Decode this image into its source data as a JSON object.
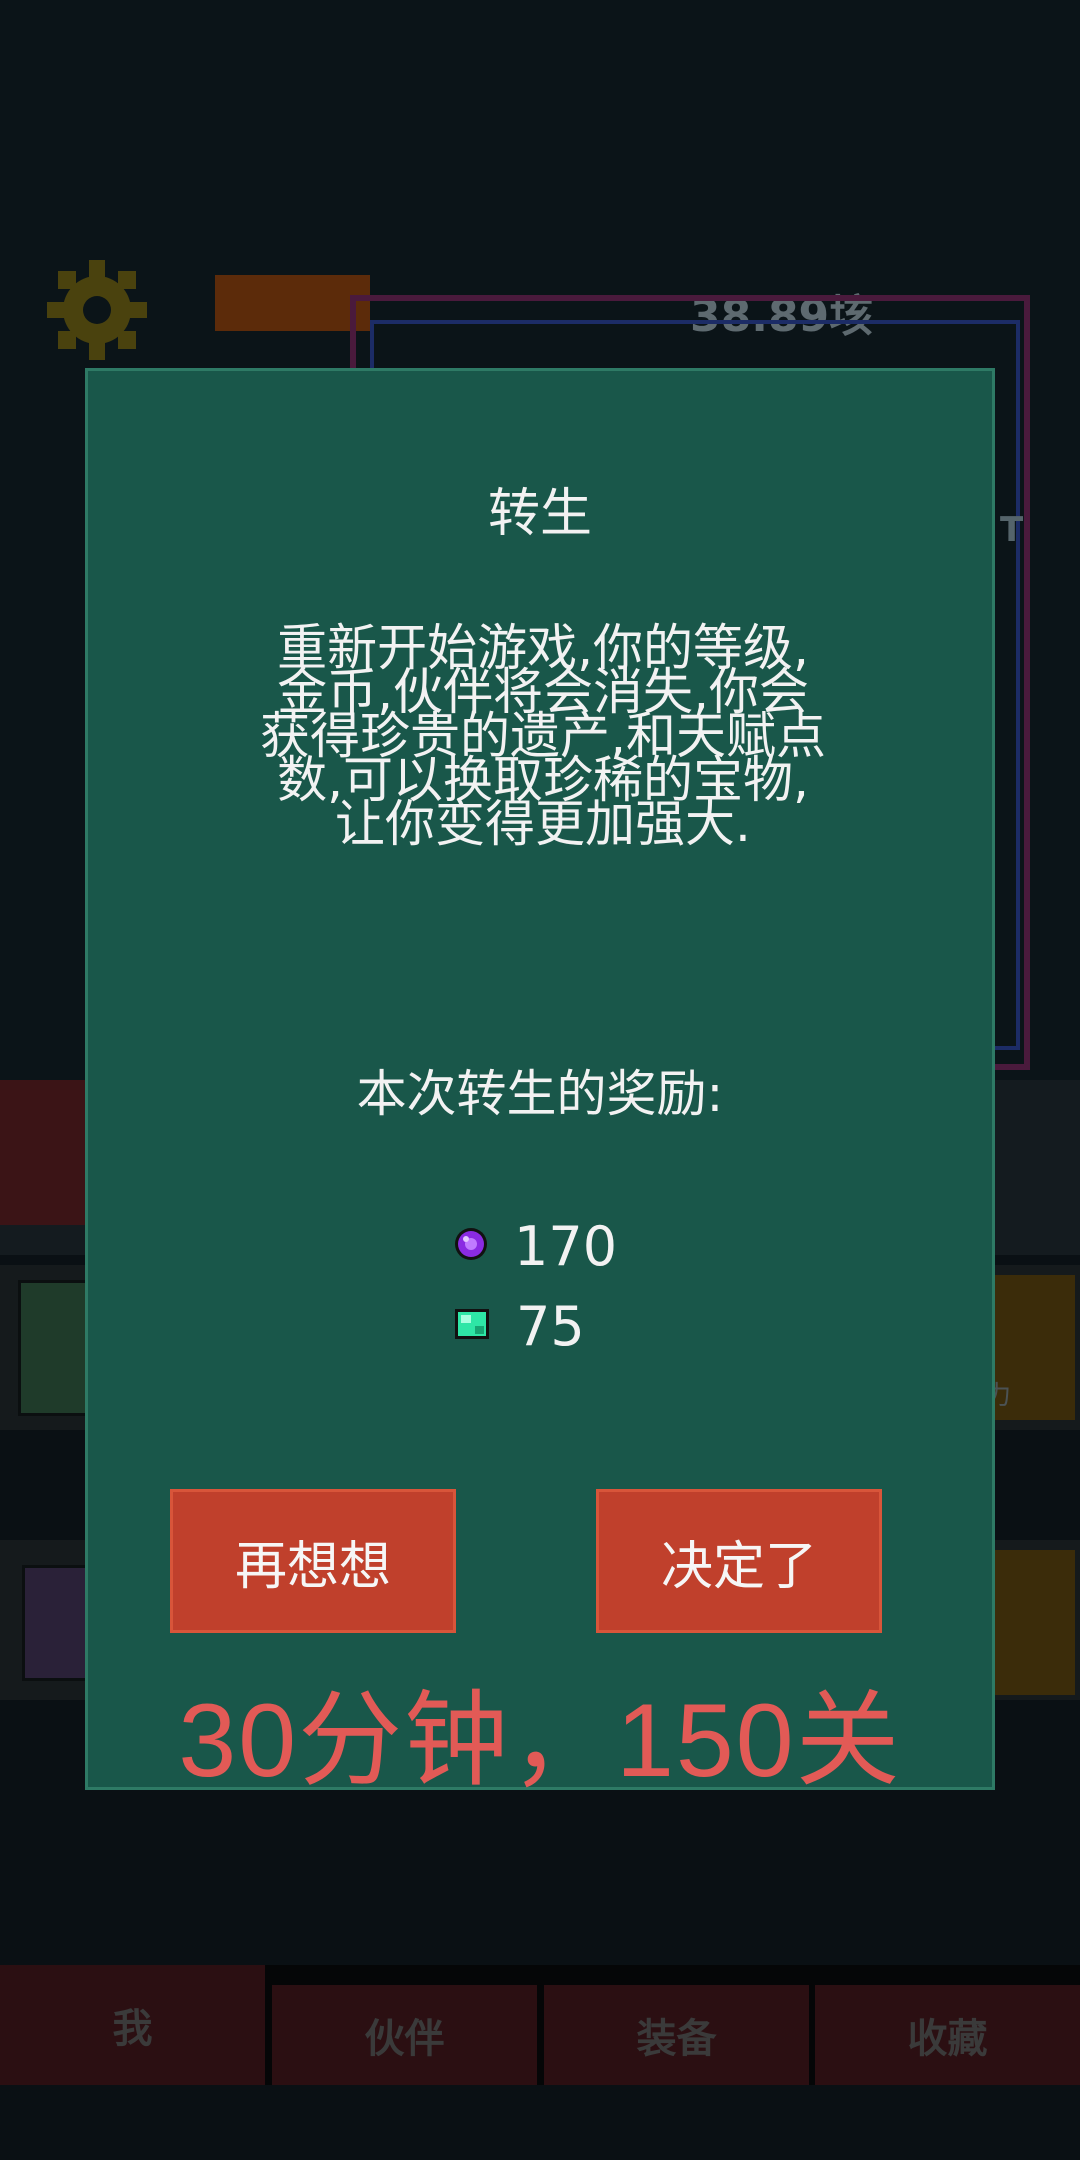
{
  "background": {
    "gold_amount": "38.89垓",
    "stage_side_label": "T",
    "row_side_text": "力"
  },
  "tabs": [
    {
      "label": "我"
    },
    {
      "label": "伙伴"
    },
    {
      "label": "装备"
    },
    {
      "label": "收藏"
    }
  ],
  "dialog": {
    "title": "转生",
    "description_lines": [
      "重新开始游戏,你的等级,",
      "金币,伙伴将会消失,你会",
      "获得珍贵的遗产,和天赋点",
      "数,可以换取珍稀的宝物,",
      "让你变得更加强大."
    ],
    "reward_label": "本次转生的奖励:",
    "rewards": [
      {
        "icon": "purple-orb-icon",
        "value": "170",
        "color": "#8a2be2"
      },
      {
        "icon": "green-gem-icon",
        "value": "75",
        "color": "#2ee6a6"
      }
    ],
    "cancel_label": "再想想",
    "confirm_label": "决定了"
  },
  "overlay_caption": "30分钟，150关",
  "colors": {
    "dialog_bg": "#19574a",
    "button_bg": "#c0402c",
    "caption": "#e25a56"
  }
}
